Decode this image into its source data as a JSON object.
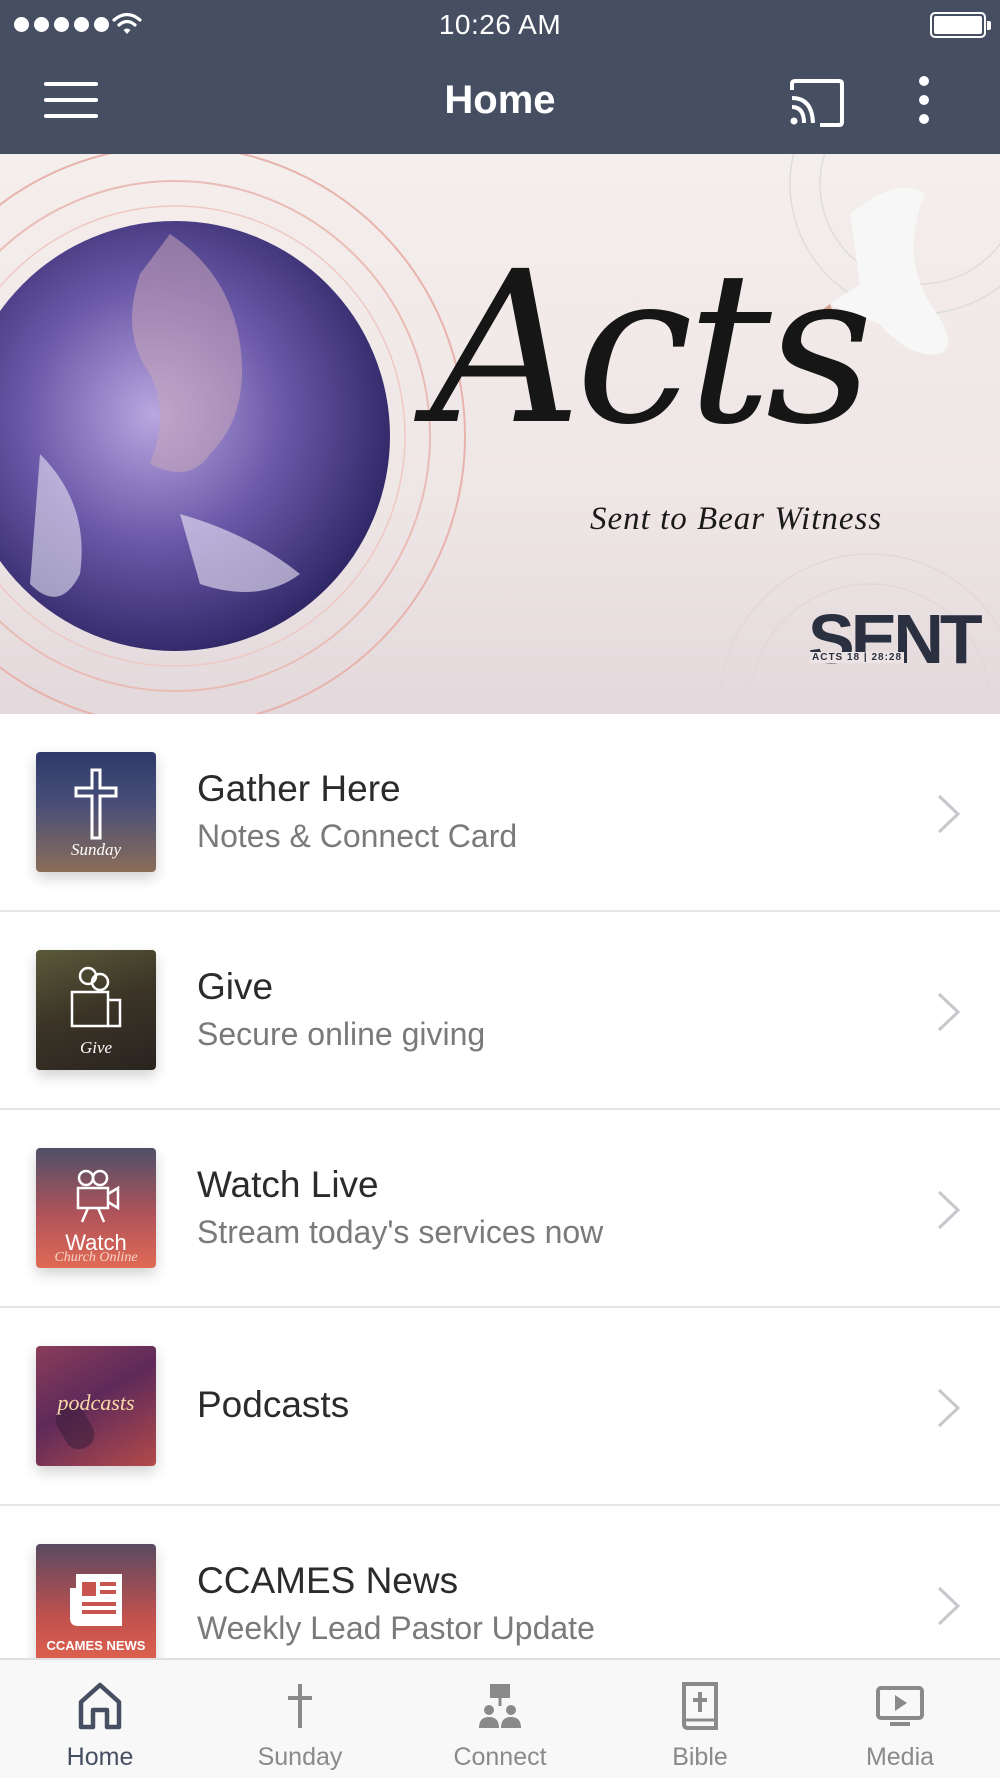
{
  "status_bar": {
    "time": "10:26 AM"
  },
  "nav": {
    "title": "Home"
  },
  "hero": {
    "title": "Acts",
    "subtitle": "Sent to Bear Witness",
    "logo_text": "SENT",
    "logo_ref": "ACTS 18 | 28:28"
  },
  "items": [
    {
      "title": "Gather Here",
      "subtitle": "Notes & Connect Card",
      "thumb_label": "Sunday",
      "icon": "cross-icon"
    },
    {
      "title": "Give",
      "subtitle": "Secure online giving",
      "thumb_label": "Give",
      "icon": "give-icon"
    },
    {
      "title": "Watch Live",
      "subtitle": "Stream today's services now",
      "thumb_label": "Watch",
      "thumb_label2": "Church Online",
      "icon": "video-camera-icon"
    },
    {
      "title": "Podcasts",
      "subtitle": "",
      "thumb_label": "podcasts",
      "icon": "microphone-icon"
    },
    {
      "title": "CCAMES News",
      "subtitle": "Weekly Lead Pastor Update",
      "thumb_label": "CCAMES NEWS",
      "icon": "newspaper-icon"
    }
  ],
  "tabs": [
    {
      "label": "Home",
      "icon": "home-icon",
      "active": true
    },
    {
      "label": "Sunday",
      "icon": "cross-icon"
    },
    {
      "label": "Connect",
      "icon": "connect-icon"
    },
    {
      "label": "Bible",
      "icon": "bible-icon"
    },
    {
      "label": "Media",
      "icon": "media-icon"
    }
  ],
  "colors": {
    "nav_bar": "#464e62",
    "active_tab": "#464e62",
    "inactive_tab": "#8a8a8a"
  }
}
